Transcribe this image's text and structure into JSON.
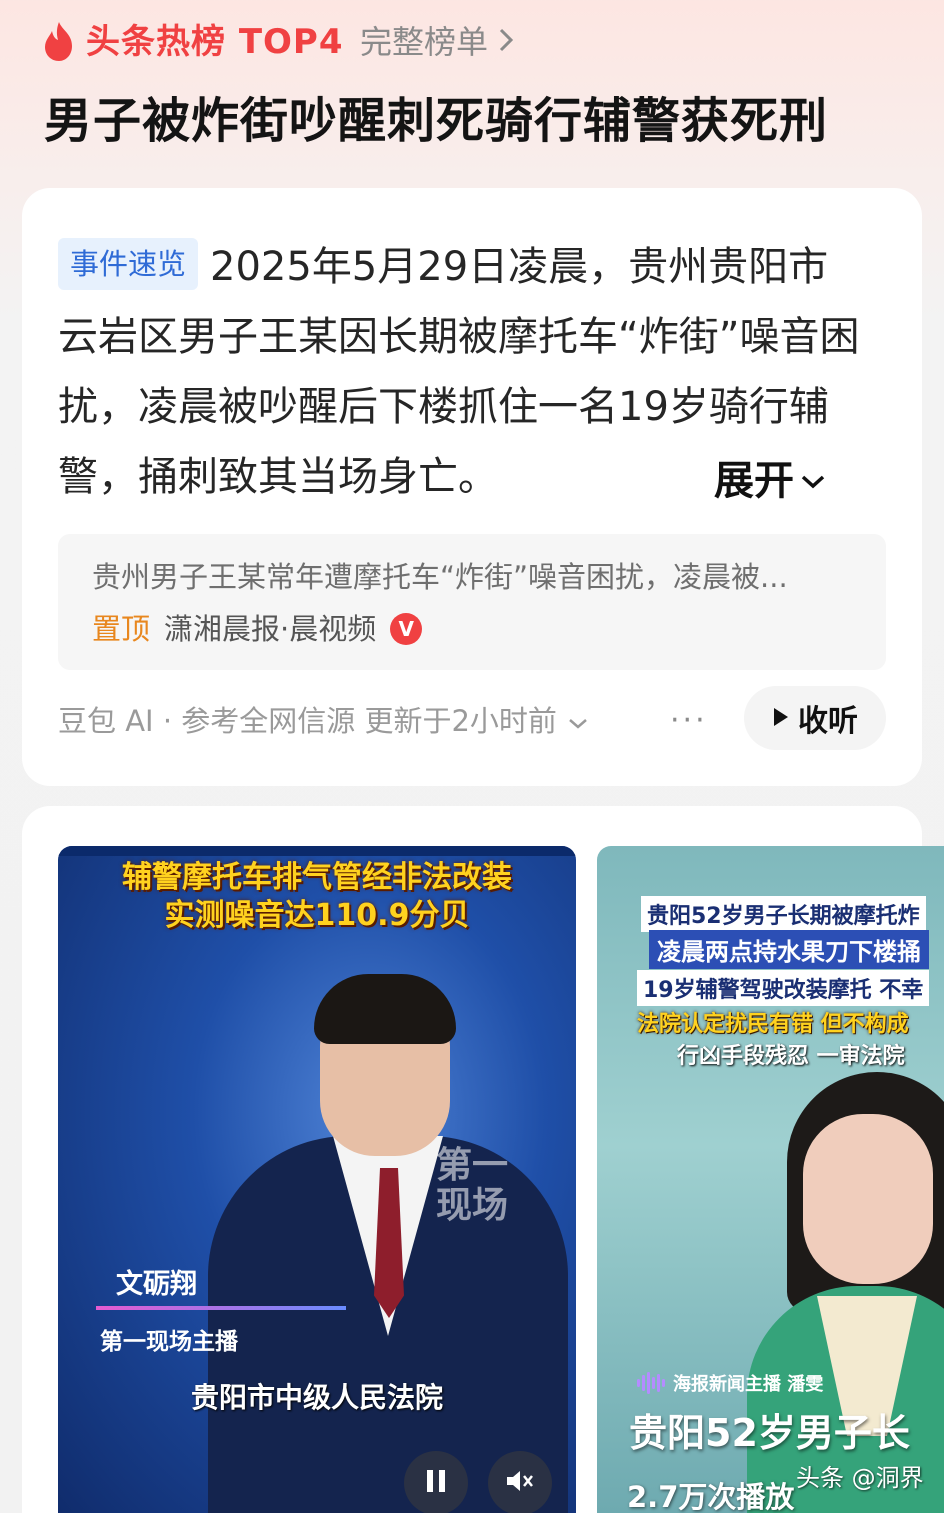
{
  "header": {
    "brand": "头条热榜 TOP4",
    "full_list": "完整榜单",
    "headline": "男子被炸街吵醒刺死骑行辅警获死刑"
  },
  "summary_card": {
    "tag": "事件速览",
    "text": "2025年5月29日凌晨，贵州贵阳市云岩区男子王某因长期被摩托车“炸街”噪音困扰，凌晨被吵醒后下楼抓住一名19岁骑行辅警，捅刺致其当场身亡。",
    "expand": "展开",
    "source": {
      "text": "贵州男子王某常年遭摩托车“炸街”噪音困扰，凌晨被...",
      "pin": "置顶",
      "media": "潇湘晨报·晨视频",
      "verified": "V"
    },
    "ai_line": "豆包 AI · 参考全网信源 更新于2小时前",
    "more": "···",
    "listen": "收听"
  },
  "videos": [
    {
      "caption_line1": "辅警摩托车排气管经非法改装",
      "caption_line2": "实测噪音达110.9分贝",
      "watermark_1": "第一",
      "watermark_2": "现场",
      "anchor_name": "文砺翔",
      "anchor_role": "第一现场主播",
      "location": "贵阳市中级人民法院"
    },
    {
      "cap1": "贵阳52岁男子长期被摩托炸",
      "cap2": "凌晨两点持水果刀下楼捅",
      "cap3": "19岁辅警驾驶改装摩托 不幸",
      "cap4": "法院认定扰民有错 但不构成",
      "cap5": "行凶手段残忍 一审法院",
      "host": "海报新闻主播 潘雯",
      "big": "贵阳52岁男子长",
      "plays": "2.7万次播放"
    }
  ],
  "footer_watermark": "头条 @洞界",
  "colors": {
    "brand_red": "#f04142",
    "tag_blue": "#2f6bd6",
    "pin_orange": "#e8871e",
    "caption_yellow": "#ffd21f"
  }
}
